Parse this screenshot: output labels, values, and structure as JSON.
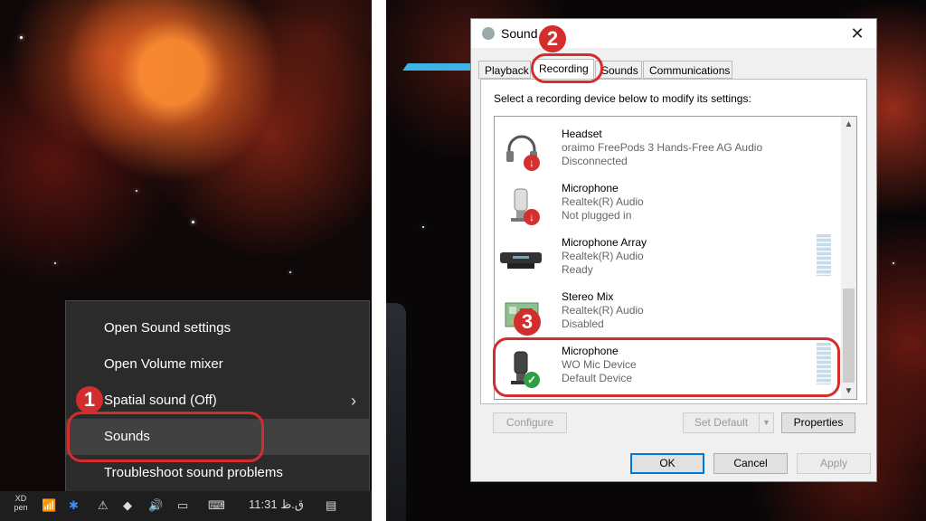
{
  "context_menu": {
    "items": [
      {
        "label": "Open Sound settings"
      },
      {
        "label": "Open Volume mixer"
      },
      {
        "label": "Spatial sound (Off)",
        "chevron": "›"
      },
      {
        "label": "Sounds"
      },
      {
        "label": "Troubleshoot sound problems"
      }
    ]
  },
  "taskbar": {
    "xd_label": "XD",
    "pen_label": "pen",
    "clock": "11:31 ق.ظ"
  },
  "markers": {
    "step1": "1",
    "step2": "2",
    "step3": "3"
  },
  "dialog": {
    "title": "Sound",
    "close_glyph": "✕",
    "tabs": [
      {
        "label": "Playback"
      },
      {
        "label": "Recording"
      },
      {
        "label": "Sounds"
      },
      {
        "label": "Communications"
      }
    ],
    "instruction": "Select a recording device below to modify its settings:",
    "devices": [
      {
        "name": "Headset",
        "line1": "oraimo FreePods 3 Hands-Free AG Audio",
        "line2": "Disconnected",
        "icon": "headset-icon",
        "status": "disconnected"
      },
      {
        "name": "Microphone",
        "line1": "Realtek(R) Audio",
        "line2": "Not plugged in",
        "icon": "microphone-icon",
        "status": "unplugged"
      },
      {
        "name": "Microphone Array",
        "line1": "Realtek(R) Audio",
        "line2": "Ready",
        "icon": "microphone-array-icon",
        "status": "ready"
      },
      {
        "name": "Stereo Mix",
        "line1": "Realtek(R) Audio",
        "line2": "Disabled",
        "icon": "stereo-mix-icon",
        "status": "disabled"
      },
      {
        "name": "Microphone",
        "line1": "WO Mic Device",
        "line2": "Default Device",
        "icon": "microphone-icon",
        "status": "default"
      }
    ],
    "buttons": {
      "configure": "Configure",
      "set_default": "Set Default",
      "properties": "Properties",
      "ok": "OK",
      "cancel": "Cancel",
      "apply": "Apply"
    }
  },
  "colors": {
    "highlight_ring": "#d32d2d",
    "menu_bg": "#2b2b2b",
    "accent": "#0078d7"
  }
}
